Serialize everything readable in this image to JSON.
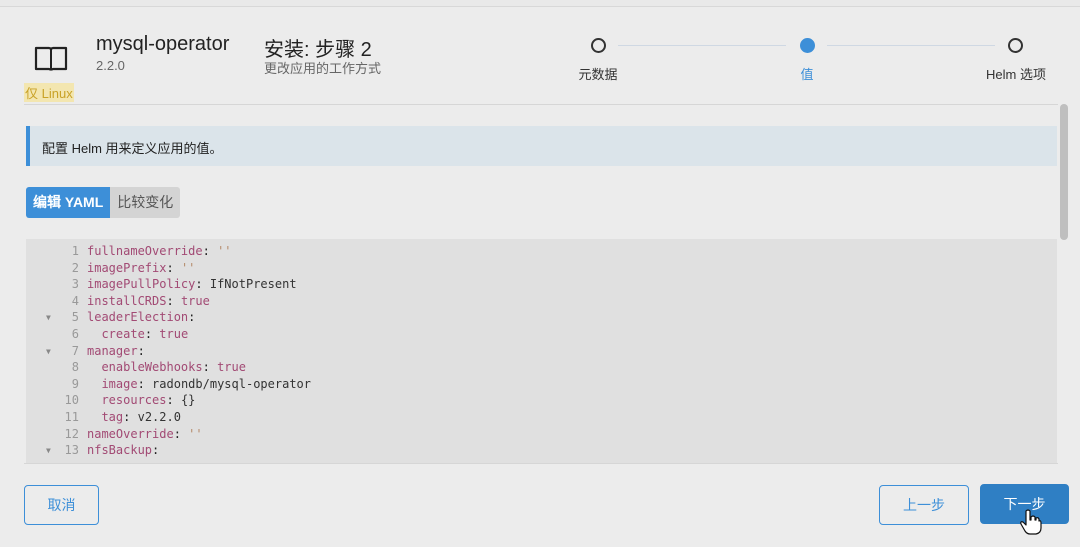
{
  "header": {
    "app_name": "mysql-operator",
    "app_version": "2.2.0",
    "os_badge": "仅 Linux",
    "step_title": "安装: 步骤 2",
    "step_subtitle": "更改应用的工作方式"
  },
  "stepper": [
    {
      "label": "元数据",
      "active": false
    },
    {
      "label": "值",
      "active": true
    },
    {
      "label": "Helm 选项",
      "active": false
    }
  ],
  "info_banner": "配置 Helm 用来定义应用的值。",
  "view_toggle": {
    "edit_yaml": "编辑 YAML",
    "compare": "比较变化"
  },
  "yaml_lines": [
    {
      "n": "1",
      "fold": false,
      "indent": 0,
      "key": "fullnameOverride",
      "value": "''",
      "vtype": "s"
    },
    {
      "n": "2",
      "fold": false,
      "indent": 0,
      "key": "imagePrefix",
      "value": "''",
      "vtype": "s"
    },
    {
      "n": "3",
      "fold": false,
      "indent": 0,
      "key": "imagePullPolicy",
      "value": "IfNotPresent",
      "vtype": "v"
    },
    {
      "n": "4",
      "fold": false,
      "indent": 0,
      "key": "installCRDS",
      "value": "true",
      "vtype": "kw"
    },
    {
      "n": "5",
      "fold": true,
      "indent": 0,
      "key": "leaderElection",
      "value": "",
      "vtype": "v"
    },
    {
      "n": "6",
      "fold": false,
      "indent": 1,
      "key": "create",
      "value": "true",
      "vtype": "kw"
    },
    {
      "n": "7",
      "fold": true,
      "indent": 0,
      "key": "manager",
      "value": "",
      "vtype": "v"
    },
    {
      "n": "8",
      "fold": false,
      "indent": 1,
      "key": "enableWebhooks",
      "value": "true",
      "vtype": "kw"
    },
    {
      "n": "9",
      "fold": false,
      "indent": 1,
      "key": "image",
      "value": "radondb/mysql-operator",
      "vtype": "v"
    },
    {
      "n": "10",
      "fold": false,
      "indent": 1,
      "key": "resources",
      "value": "{}",
      "vtype": "v"
    },
    {
      "n": "11",
      "fold": false,
      "indent": 1,
      "key": "tag",
      "value": "v2.2.0",
      "vtype": "v"
    },
    {
      "n": "12",
      "fold": false,
      "indent": 0,
      "key": "nameOverride",
      "value": "''",
      "vtype": "s"
    },
    {
      "n": "13",
      "fold": true,
      "indent": 0,
      "key": "nfsBackup",
      "value": "",
      "vtype": "v"
    }
  ],
  "footer": {
    "cancel": "取消",
    "prev": "上一步",
    "next": "下一步"
  },
  "colors": {
    "accent": "#3d8fd8",
    "primary_button": "#2f7fc4",
    "yaml_key": "#a24a74"
  },
  "icons": {
    "app": "book-icon",
    "fold": "caret-down-icon",
    "cursor": "hand-pointer-icon"
  }
}
